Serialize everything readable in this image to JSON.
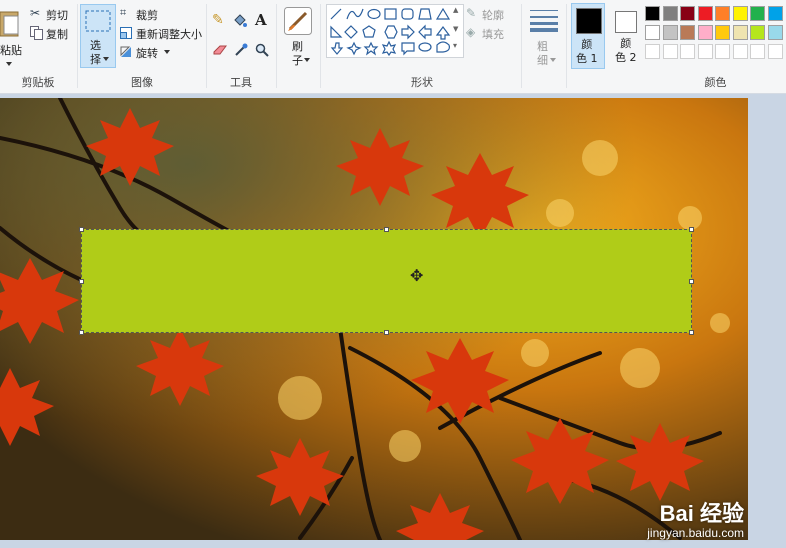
{
  "clipboard": {
    "paste_label": "粘贴",
    "cut_label": "剪切",
    "copy_label": "复制",
    "group_label": "剪贴板"
  },
  "image": {
    "select_label": "选\n择",
    "crop_label": "裁剪",
    "resize_label": "重新调整大小",
    "rotate_label": "旋转",
    "group_label": "图像"
  },
  "tools": {
    "group_label": "工具"
  },
  "brushes": {
    "label": "刷\n子"
  },
  "shapes": {
    "outline_label": "轮廓",
    "fill_label": "填充",
    "group_label": "形状"
  },
  "size": {
    "label": "粗\n细"
  },
  "color1": {
    "label": "颜\n色 1",
    "value": "#000000"
  },
  "color2": {
    "label": "颜\n色 2",
    "value": "#ffffff"
  },
  "colors": {
    "group_label": "颜色",
    "palette_row1": [
      "#000000",
      "#7f7f7f",
      "#880015",
      "#ed1c24",
      "#ff7f27",
      "#fff200",
      "#22b14c",
      "#00a2e8"
    ],
    "palette_row2": [
      "#ffffff",
      "#c3c3c3",
      "#b97a57",
      "#ffaec9",
      "#ffc90e",
      "#efe4b0",
      "#b5e61d",
      "#99d9ea"
    ]
  },
  "canvas": {
    "selection_fill": "#b0cc18"
  },
  "watermark": {
    "brand": "Bai 经验",
    "url": "jingyan.baidu.com"
  }
}
